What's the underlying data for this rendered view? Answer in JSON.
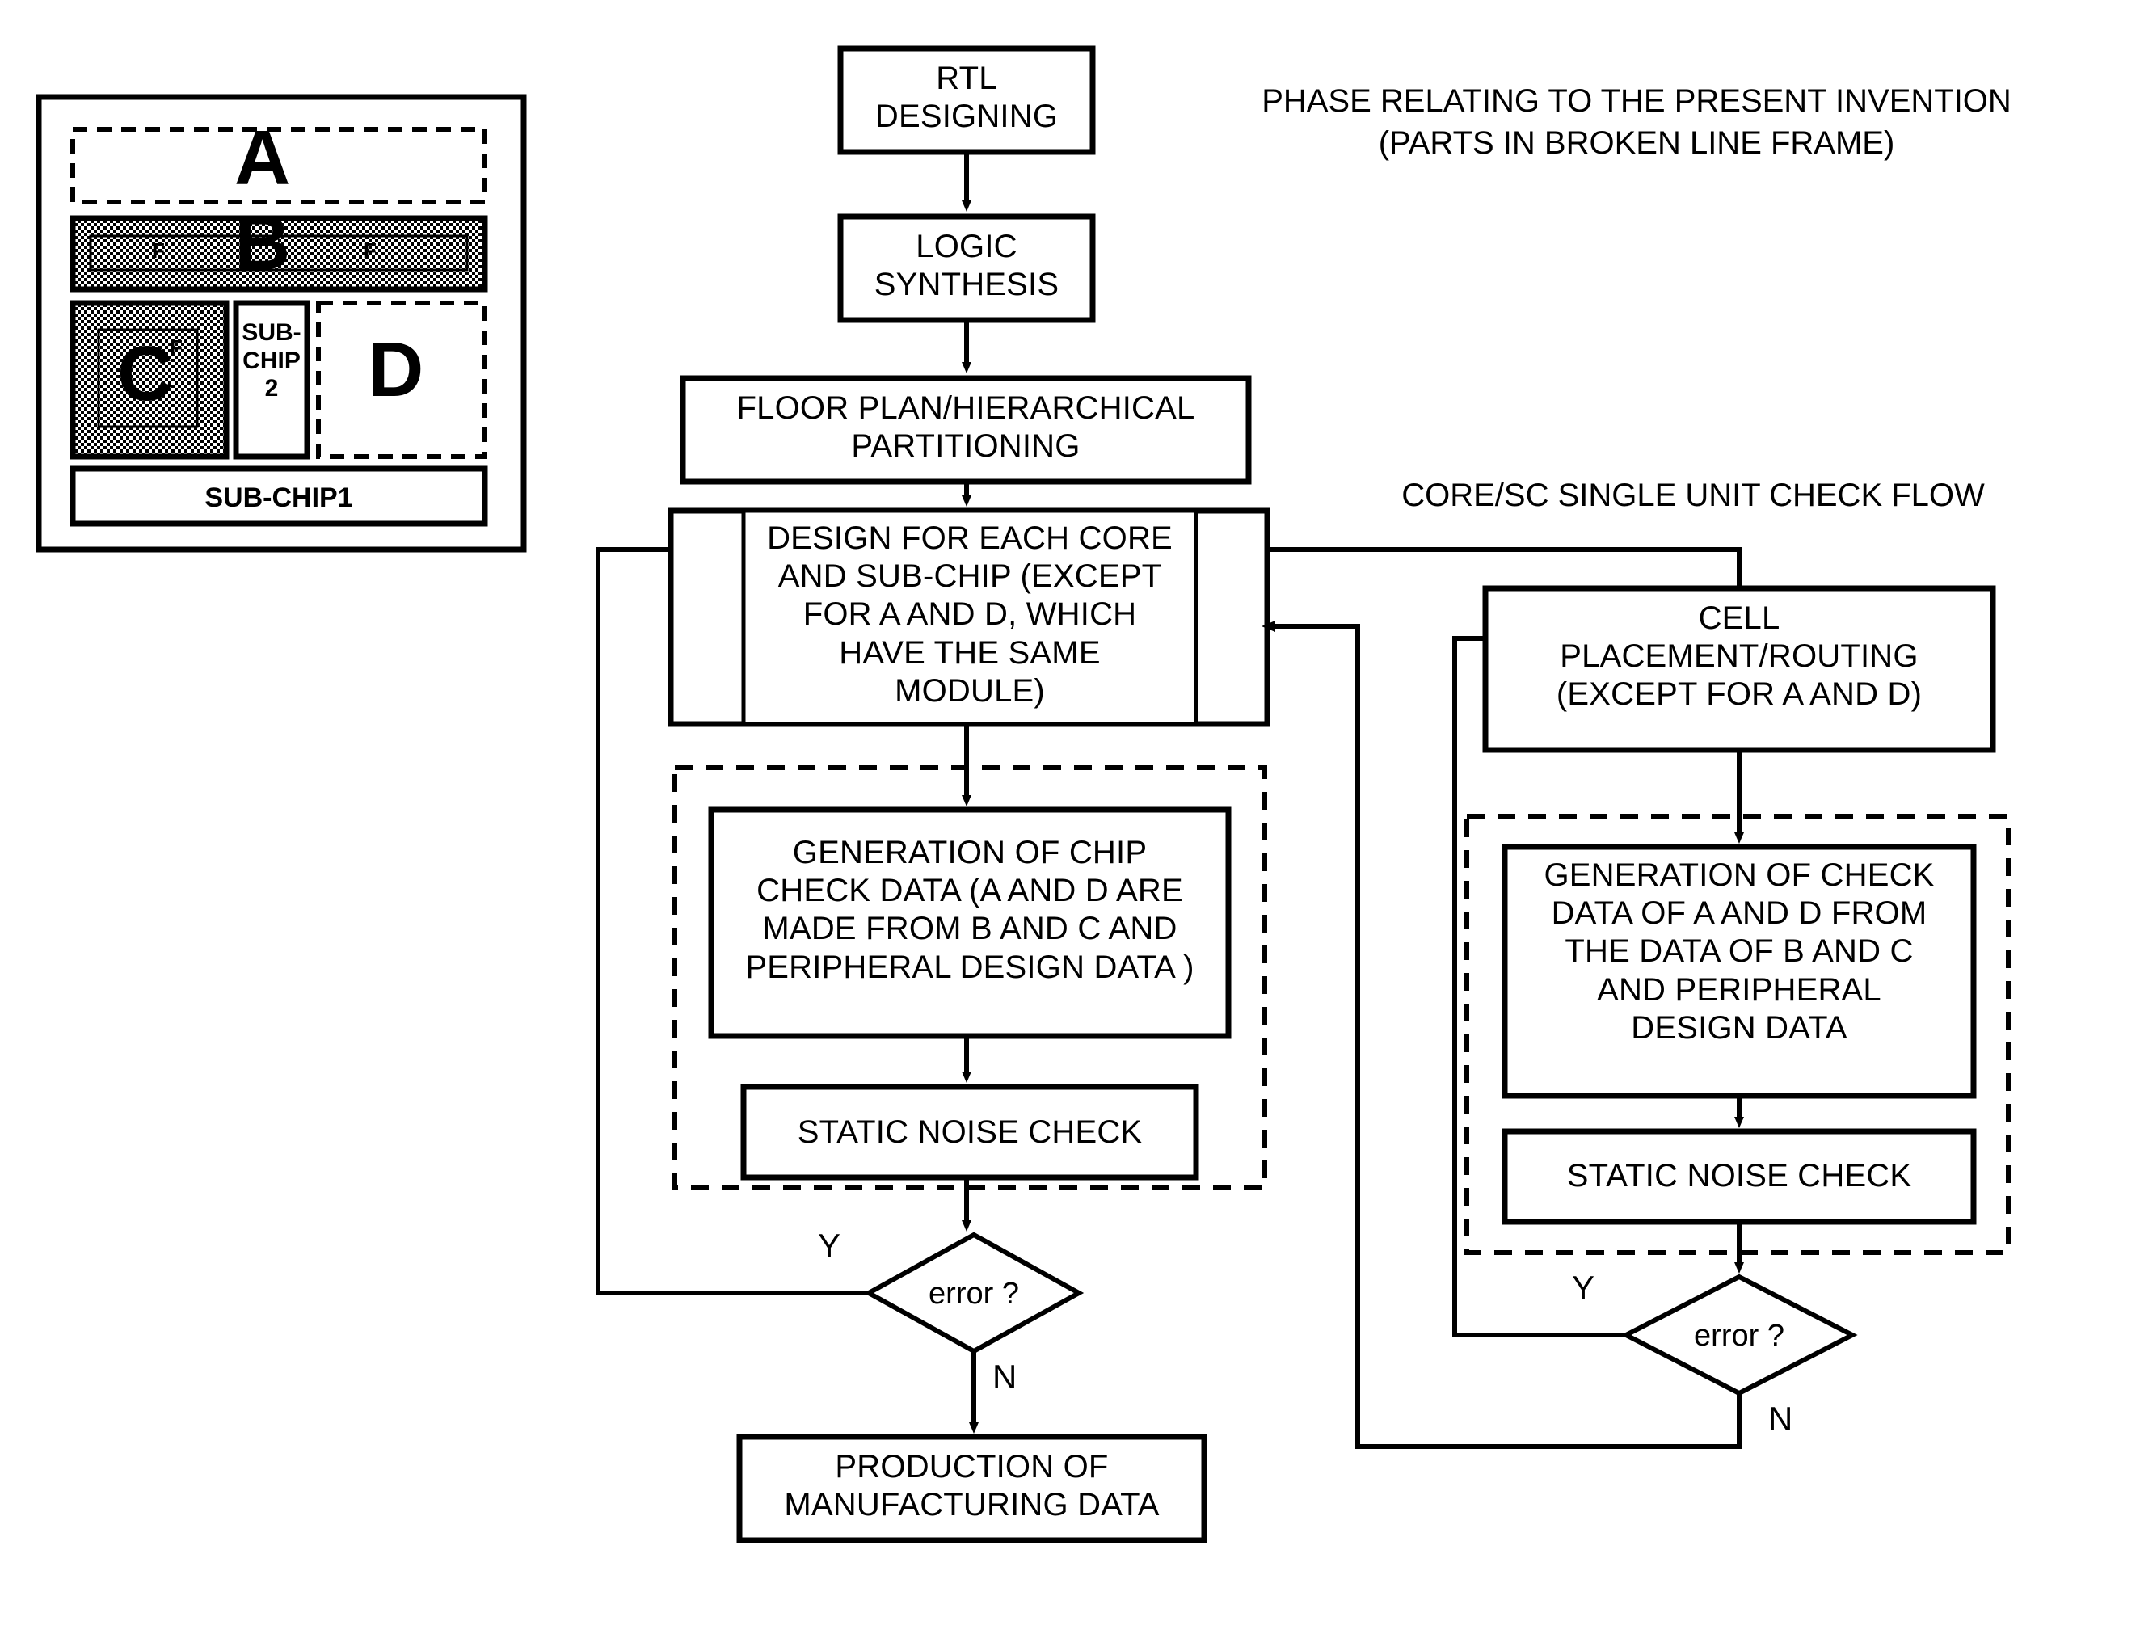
{
  "diagram": {
    "type": "flowchart",
    "annotations": {
      "phase_note_line1": "PHASE RELATING TO THE PRESENT INVENTION",
      "phase_note_line2": "(PARTS IN BROKEN LINE FRAME)",
      "core_sc_note": "CORE/SC SINGLE UNIT CHECK FLOW"
    },
    "chip_layout": {
      "regions": [
        {
          "id": "A",
          "label": "A",
          "style": "dashed"
        },
        {
          "id": "B",
          "label": "B",
          "style": "hatched",
          "sub_labels": [
            "F",
            "F"
          ]
        },
        {
          "id": "C",
          "label": "C",
          "style": "hatched",
          "sub_labels": [
            "F"
          ]
        },
        {
          "id": "D",
          "label": "D",
          "style": "dashed"
        }
      ],
      "sub_chip_2": "SUB-\nCHIP\n2",
      "sub_chip_1": "SUB-CHIP1"
    },
    "nodes": {
      "rtl": "RTL\nDESIGNING",
      "logic": "LOGIC\nSYNTHESIS",
      "floorplan": "FLOOR PLAN/HIERARCHICAL\nPARTITIONING",
      "design_each_core": "DESIGN FOR EACH CORE\nAND SUB-CHIP (EXCEPT\nFOR A AND D, WHICH\nHAVE THE SAME\nMODULE)",
      "gen_chip_check": "GENERATION OF CHIP\nCHECK DATA (A AND D ARE\nMADE FROM B AND C AND\nPERIPHERAL DESIGN DATA )",
      "static_noise_left": "STATIC NOISE CHECK",
      "error_left": "error ?",
      "production": "PRODUCTION OF\nMANUFACTURING DATA",
      "cell_placement": "CELL\nPLACEMENT/ROUTING\n(EXCEPT FOR A AND D)",
      "gen_check_ad": "GENERATION OF CHECK\nDATA OF A AND D FROM\nTHE DATA OF B AND C\nAND PERIPHERAL\nDESIGN DATA",
      "static_noise_right": "STATIC NOISE CHECK",
      "error_right": "error ?"
    },
    "branch_labels": {
      "left_yes": "Y",
      "left_no": "N",
      "right_yes": "Y",
      "right_no": "N"
    },
    "colors": {
      "stroke": "#000000",
      "background": "#ffffff",
      "hatch": "#000000"
    }
  }
}
